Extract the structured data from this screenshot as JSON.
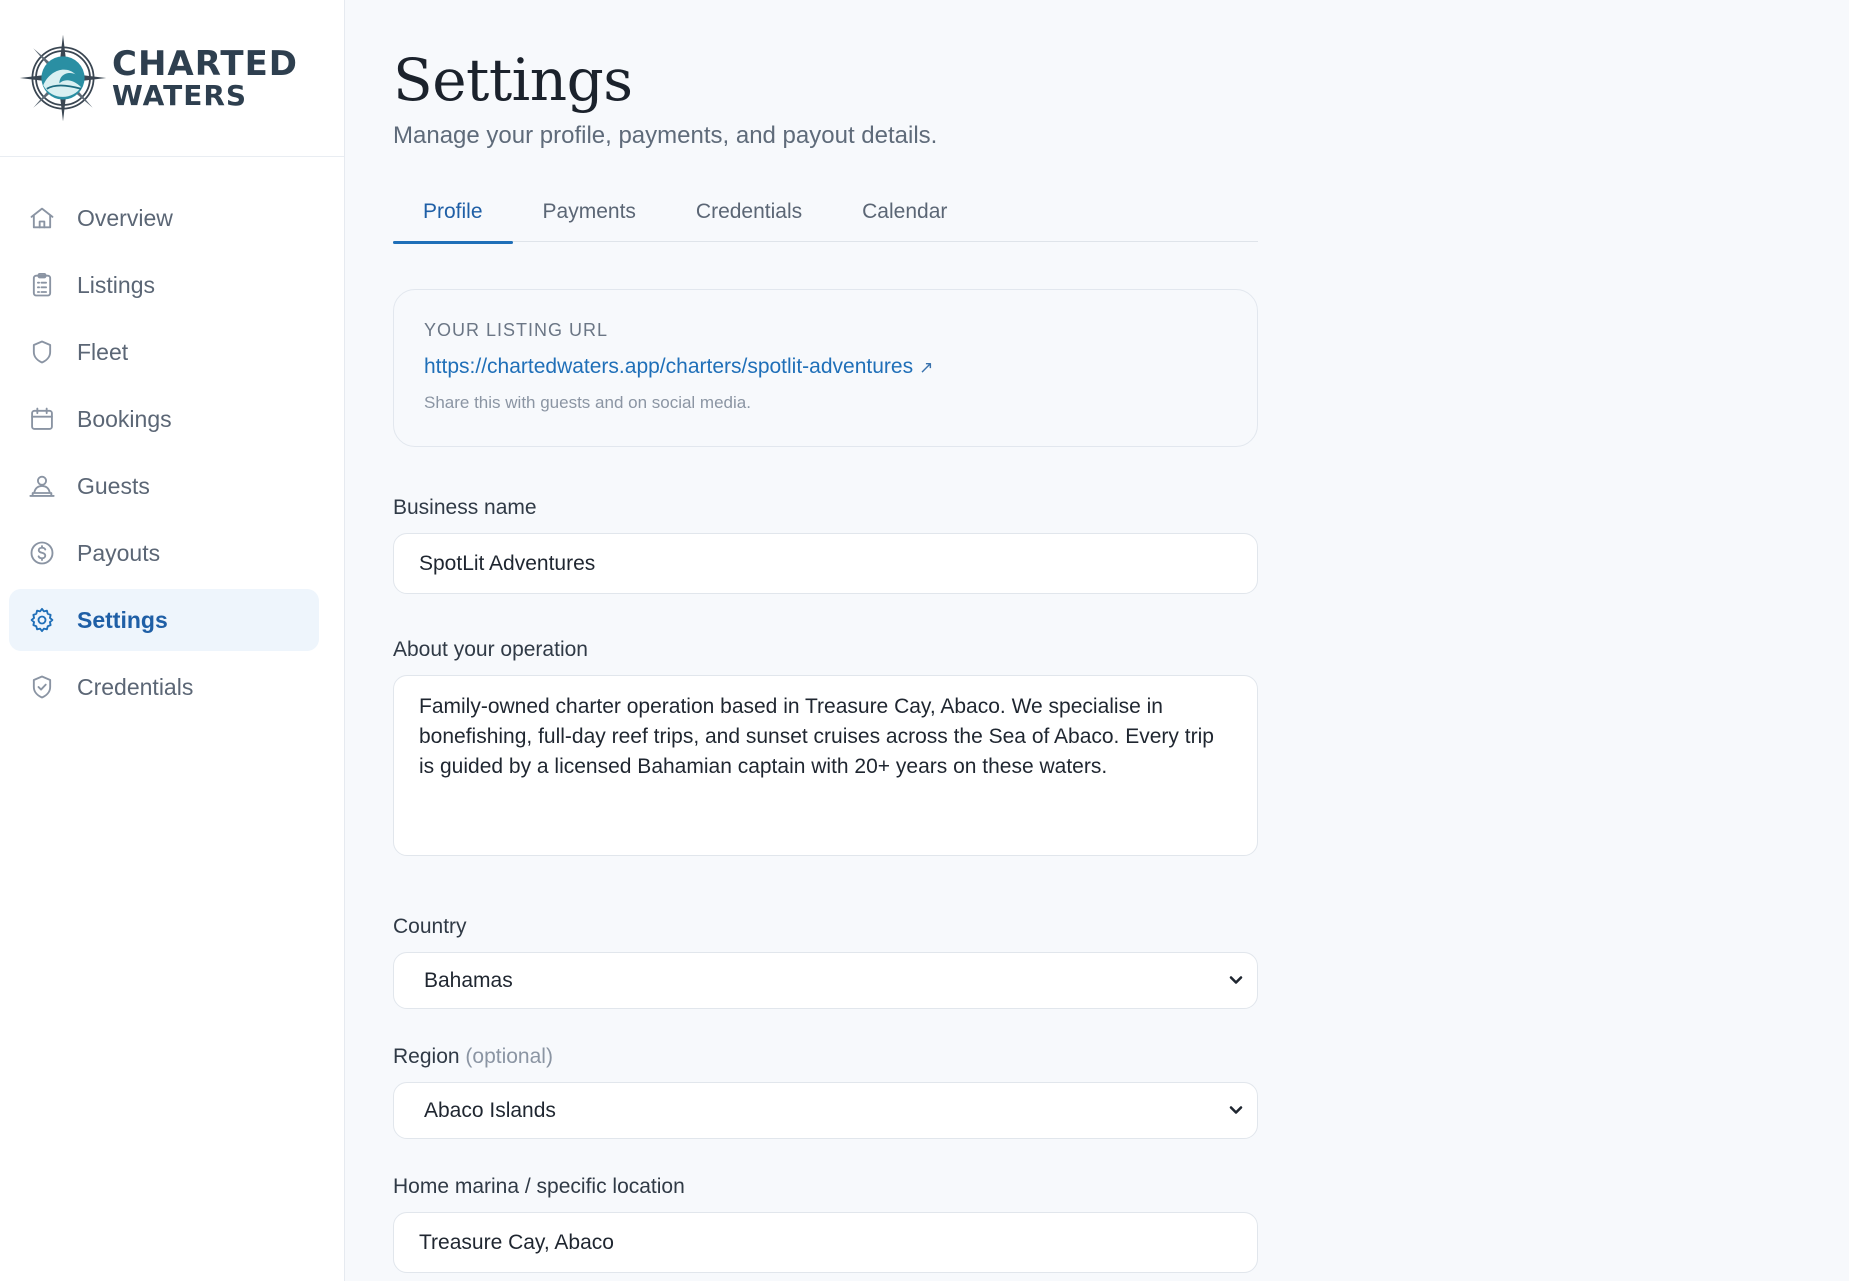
{
  "brand": {
    "line1": "CHARTED",
    "line2": "WATERS",
    "accent": "#1f6fb8"
  },
  "sidebar": {
    "items": [
      {
        "label": "Overview",
        "icon": "home-icon",
        "active": false
      },
      {
        "label": "Listings",
        "icon": "clipboard-icon",
        "active": false
      },
      {
        "label": "Fleet",
        "icon": "shield-icon",
        "active": false
      },
      {
        "label": "Bookings",
        "icon": "calendar-icon",
        "active": false
      },
      {
        "label": "Guests",
        "icon": "users-icon",
        "active": false
      },
      {
        "label": "Payouts",
        "icon": "dollar-circle-icon",
        "active": false
      },
      {
        "label": "Settings",
        "icon": "gear-icon",
        "active": true
      },
      {
        "label": "Credentials",
        "icon": "shield-check-icon",
        "active": false
      }
    ]
  },
  "header": {
    "title": "Settings",
    "subtitle": "Manage your profile, payments, and payout details."
  },
  "tabs": [
    {
      "label": "Profile",
      "active": true
    },
    {
      "label": "Payments",
      "active": false
    },
    {
      "label": "Credentials",
      "active": false
    },
    {
      "label": "Calendar",
      "active": false
    }
  ],
  "listing_url": {
    "label": "YOUR LISTING URL",
    "url": "https://chartedwaters.app/charters/spotlit-adventures",
    "external_glyph": "↗",
    "hint": "Share this with guests and on social media."
  },
  "form": {
    "business_name": {
      "label": "Business name",
      "value": "SpotLit Adventures"
    },
    "about": {
      "label": "About your operation",
      "value": "Family-owned charter operation based in Treasure Cay, Abaco. We specialise in bonefishing, full-day reef trips, and sunset cruises across the Sea of Abaco. Every trip is guided by a licensed Bahamian captain with 20+ years on these waters."
    },
    "country": {
      "label": "Country",
      "value": "Bahamas"
    },
    "region": {
      "label": "Region",
      "optional": "(optional)",
      "value": "Abaco Islands"
    },
    "home_marina": {
      "label": "Home marina / specific location",
      "value": "Treasure Cay, Abaco"
    }
  }
}
